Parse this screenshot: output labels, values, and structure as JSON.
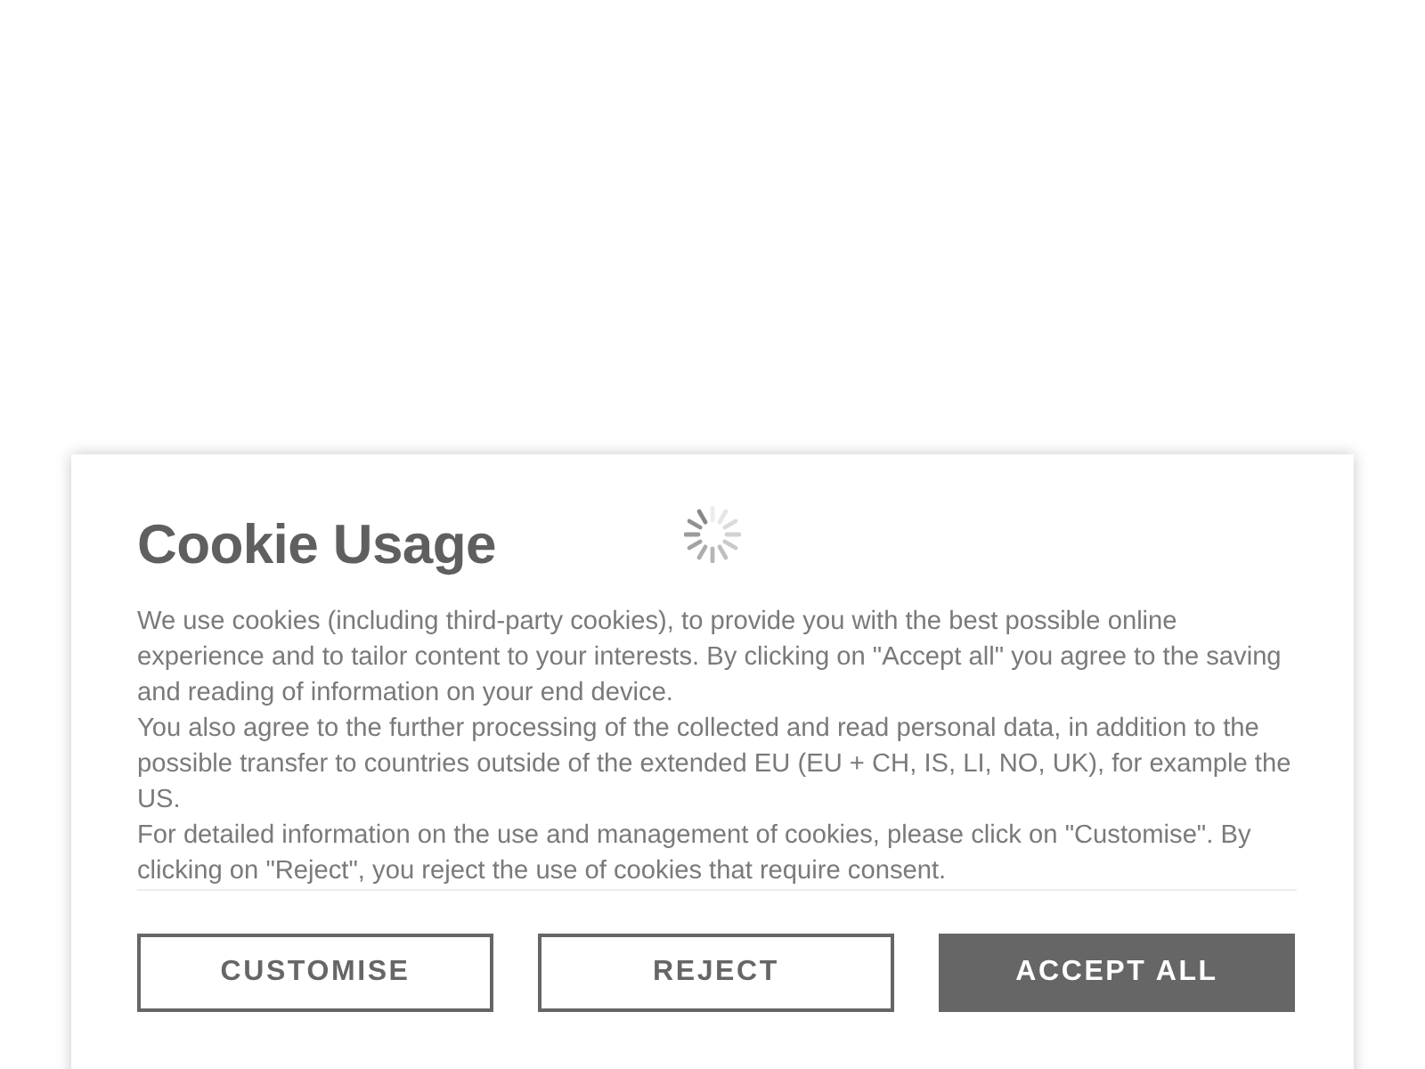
{
  "dialog": {
    "title": "Cookie Usage",
    "paragraphs": [
      "We use cookies (including third-party cookies), to provide you with the best possible online experience and to tailor content to your interests. By clicking on \"Accept all\" you agree to the saving and reading of information on your end device.",
      "You also agree to the further processing of the collected and read personal data, in addition to the possible transfer to countries outside of the extended EU (EU + CH, IS, LI, NO, UK), for example the US.",
      "For detailed information on the use and management of cookies, please click on \"Customise\". By clicking on \"Reject\", you reject the use of cookies that require consent."
    ],
    "buttons": [
      {
        "label": "CUSTOMISE",
        "kind": "outline"
      },
      {
        "label": "REJECT",
        "kind": "outline"
      },
      {
        "label": "ACCEPT ALL",
        "kind": "filled"
      }
    ]
  }
}
